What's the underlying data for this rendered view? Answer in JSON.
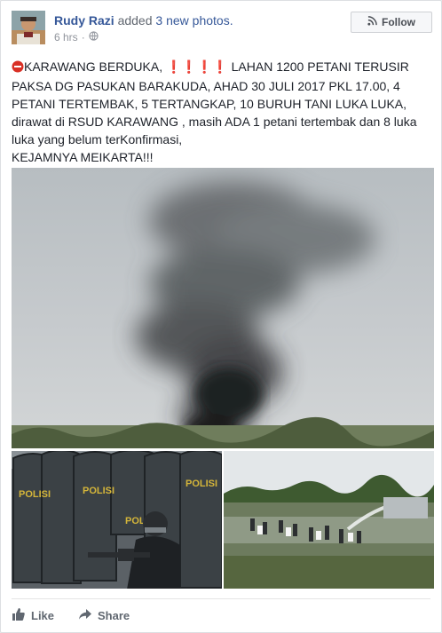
{
  "post": {
    "author": "Rudy Razi",
    "action": "added",
    "photo_count": "3 new photos.",
    "time": "6 hrs",
    "meta_separator": "·",
    "audience_icon": "globe-icon",
    "follow_label": "Follow",
    "follow_icon": "rss-icon",
    "body_lines": [
      "KARAWANG BERDUKA,",
      "LAHAN 1200 PETANI TERUSIR",
      "PAKSA DG PASUKAN BARAKUDA, AHAD 30 JULI 2017 PKL 17.00, 4",
      "PETANI TERTEMBAK, 5 TERTANGKAP, 10 BURUH TANI LUKA LUKA,",
      "dirawat di RSUD KARAWANG , masih ADA 1 petani tertembak dan 8 luka",
      "luka yang belum terKonfirmasi,",
      "KEJAMNYA MEIKARTA!!!"
    ],
    "shield_texts": [
      "POLISI",
      "POLISI",
      "POLISI",
      "POLI"
    ]
  },
  "actions": {
    "like_label": "Like",
    "share_label": "Share"
  },
  "colors": {
    "link_blue": "#365899",
    "text": "#1d2129",
    "meta_gray": "#90949c",
    "emoji_red": "#d93025"
  }
}
